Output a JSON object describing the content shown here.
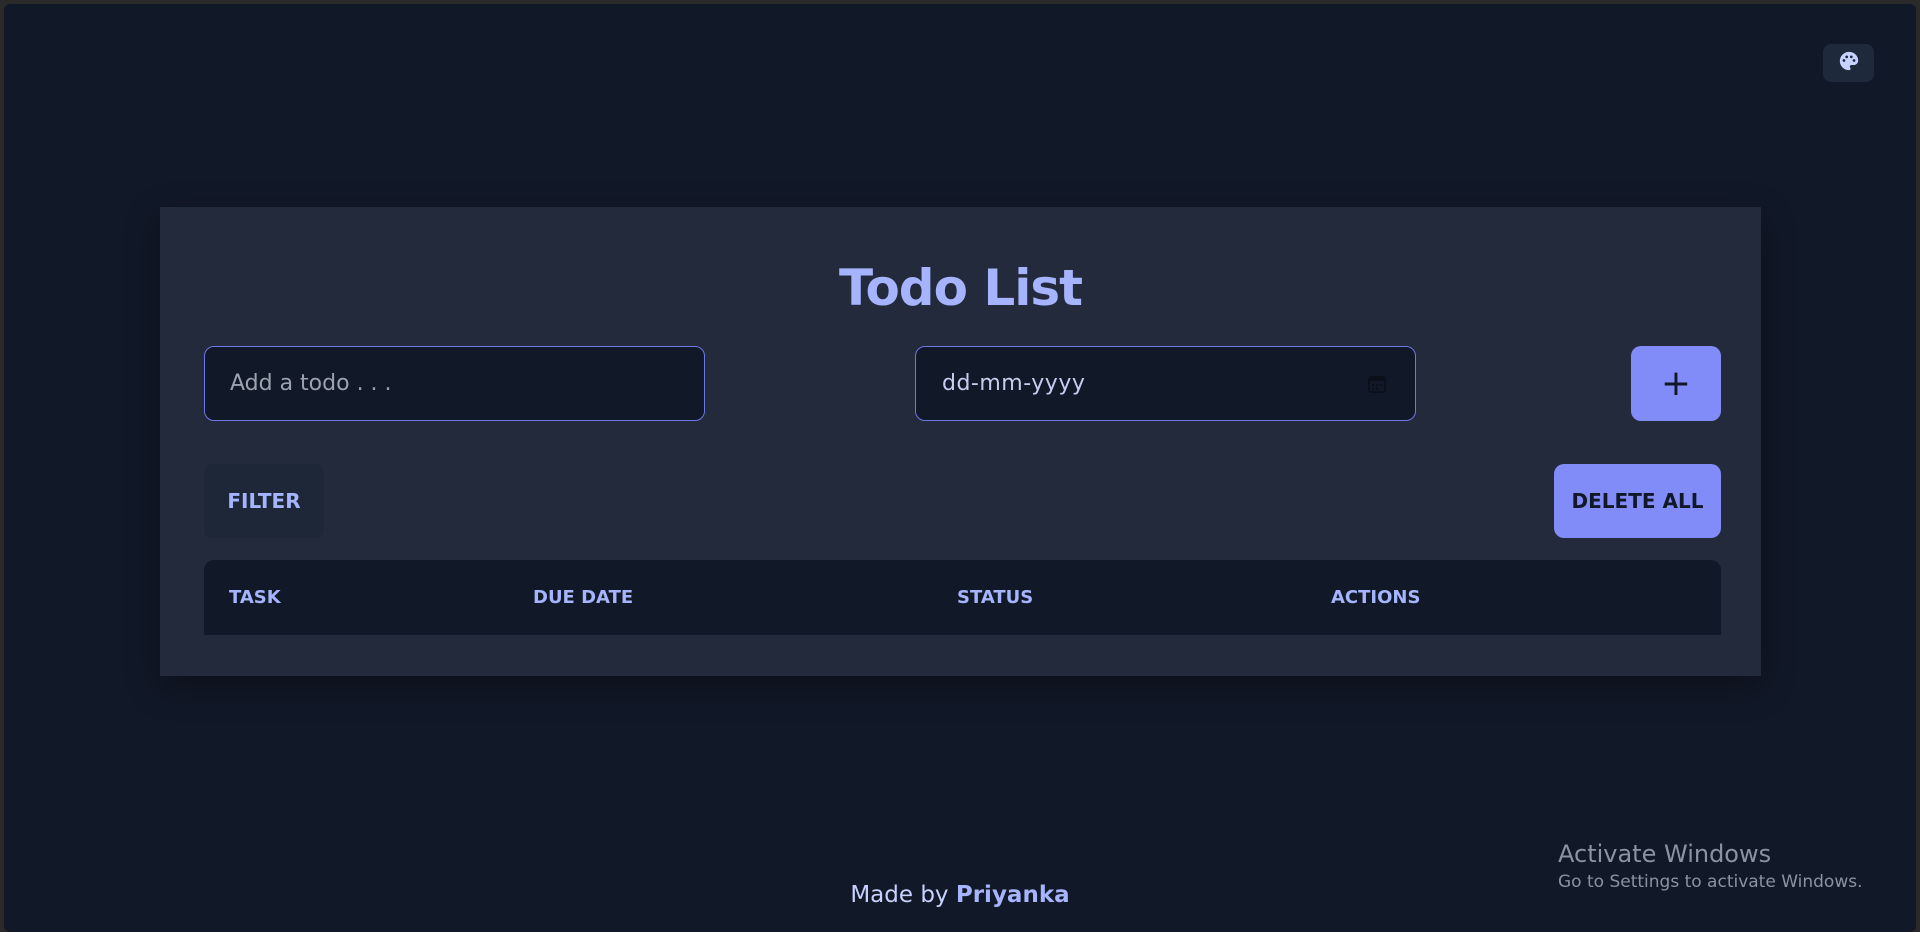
{
  "header": {
    "theme_button_icon": "palette-icon"
  },
  "card": {
    "title": "Todo List",
    "todo_input_placeholder": "Add a todo . . .",
    "date_placeholder": "dd-mm-yyyy",
    "date_icon": "calendar-icon",
    "add_button_label": "+",
    "filter_label": "FILTER",
    "delete_all_label": "DELETE ALL"
  },
  "table": {
    "columns": [
      "TASK",
      "DUE DATE",
      "STATUS",
      "ACTIONS"
    ]
  },
  "footer": {
    "prefix": "Made by",
    "author": "Priyanka"
  },
  "watermark": {
    "title": "Activate Windows",
    "subtitle": "Go to Settings to activate Windows."
  },
  "colors": {
    "background": "#111827",
    "card": "#222a3c",
    "accent": "#818cf8",
    "text_accent": "#a5b4fc"
  }
}
